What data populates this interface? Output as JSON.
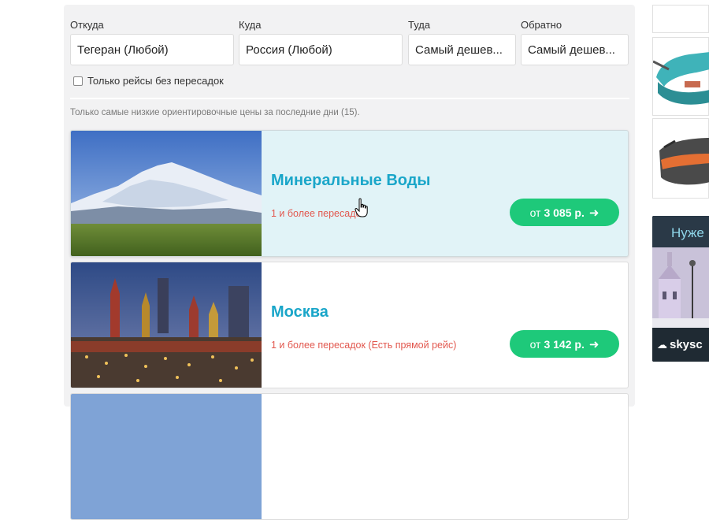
{
  "search": {
    "from_label": "Откуда",
    "from_value": "Тегеран (Любой)",
    "to_label": "Куда",
    "to_value": "Россия (Любой)",
    "depart_label": "Туда",
    "depart_value": "Самый дешев...",
    "return_label": "Обратно",
    "return_value": "Самый дешев...",
    "direct_only_label": "Только рейсы без пересадок",
    "direct_only_checked": false
  },
  "note": "Только самые низкие ориентировочные цены за последние дни (15).",
  "results": [
    {
      "city": "Минеральные Воды",
      "transfers": "1 и более пересадок",
      "price_prefix": "от",
      "price": "3 085 р.",
      "image": "mountain-photo"
    },
    {
      "city": "Москва",
      "transfers": "1 и более пересадок (Есть прямой рейс)",
      "price_prefix": "от",
      "price": "3 142 р.",
      "image": "kremlin-night-photo"
    }
  ],
  "ad": {
    "headline": "Нуже",
    "brand": "skysc"
  },
  "colors": {
    "accent": "#1aa6c9",
    "price_button": "#1ec97a",
    "transfers_text": "#e2584f",
    "active_card": "#e1f3f7"
  }
}
